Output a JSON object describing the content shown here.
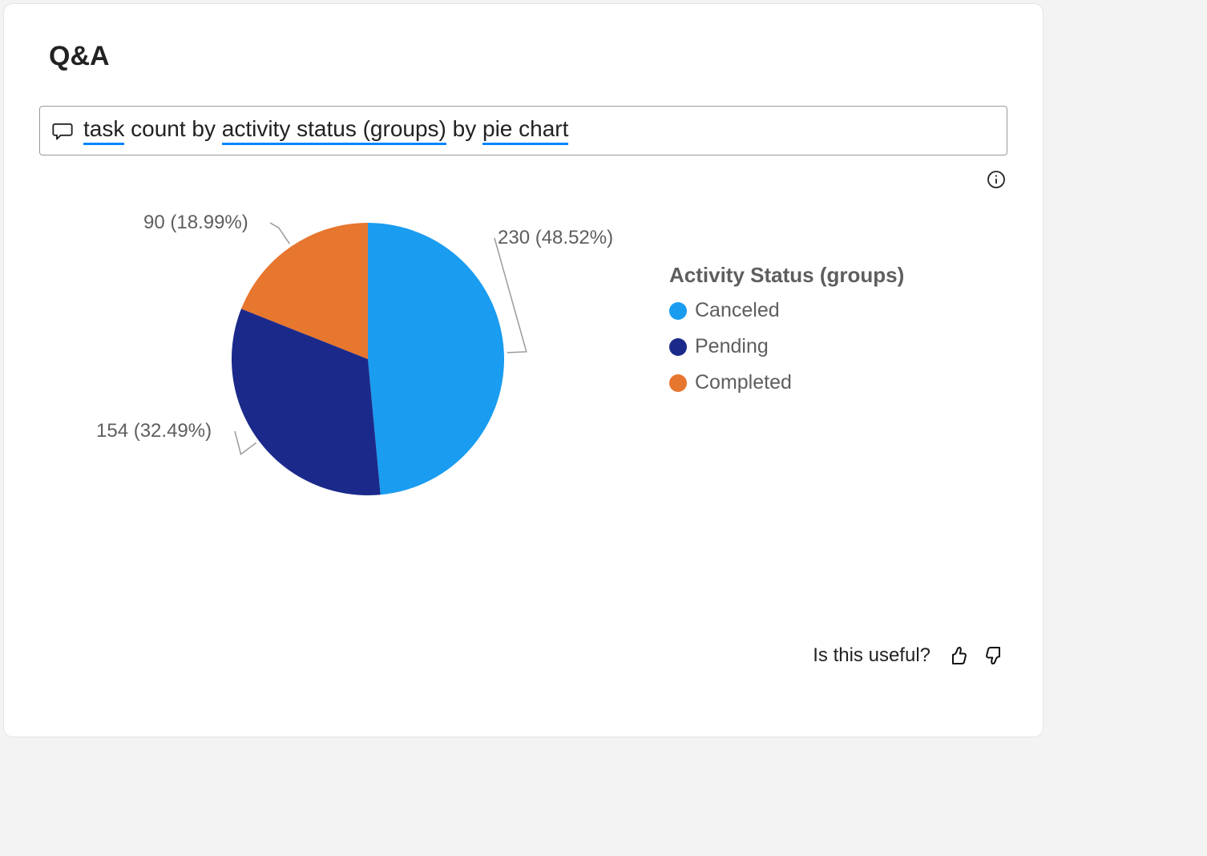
{
  "title": "Q&A",
  "query": {
    "tokens": [
      {
        "text": "task",
        "underline": true
      },
      {
        "text": " count by ",
        "underline": false
      },
      {
        "text": "activity status (groups)",
        "underline": true
      },
      {
        "text": " by ",
        "underline": false
      },
      {
        "text": "pie chart",
        "underline": true
      }
    ]
  },
  "legend_title": "Activity Status (groups)",
  "colors": {
    "canceled": "#1a9cf0",
    "pending": "#1b2a8a",
    "completed": "#e7762e",
    "text": "#5e5e5e"
  },
  "chart_data": {
    "type": "pie",
    "title": "",
    "series": [
      {
        "name": "Canceled",
        "value": 230,
        "percent": 48.52,
        "color": "#1a9cf0",
        "label": "230 (48.52%)"
      },
      {
        "name": "Pending",
        "value": 154,
        "percent": 32.49,
        "color": "#1b2a8a",
        "label": "154 (32.49%)"
      },
      {
        "name": "Completed",
        "value": 90,
        "percent": 18.99,
        "color": "#e7762e",
        "label": "90 (18.99%)"
      }
    ]
  },
  "feedback": {
    "prompt": "Is this useful?"
  }
}
